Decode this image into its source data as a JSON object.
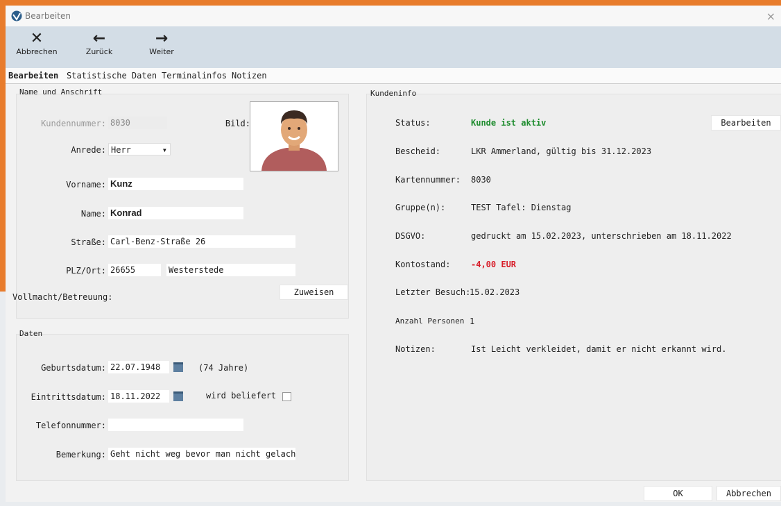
{
  "window": {
    "title": "Bearbeiten",
    "close": "×"
  },
  "toolbar": {
    "cancel": {
      "icon": "✕",
      "label": "Abbrechen"
    },
    "back": {
      "icon": "←",
      "label": "Zurück"
    },
    "forward": {
      "icon": "→",
      "label": "Weiter"
    }
  },
  "tabs": [
    "Bearbeiten",
    "Statistische Daten",
    "Terminalinfos",
    "Notizen"
  ],
  "name_section": {
    "legend": "Name und Anschrift",
    "kundennummer_label": "Kundennummer:",
    "kundennummer": "8030",
    "bild_label": "Bild:",
    "anrede_label": "Anrede:",
    "anrede": "Herr",
    "vorname_label": "Vorname:",
    "vorname": "Kunz",
    "name_label": "Name:",
    "name": "Konrad",
    "strasse_label": "Straße:",
    "strasse": "Carl-Benz-Straße 26",
    "plzort_label": "PLZ/Ort:",
    "plz": "26655",
    "ort": "Westerstede",
    "vollmacht_label": "Vollmacht/Betreuung:",
    "zuweisen": "Zuweisen"
  },
  "daten_section": {
    "legend": "Daten",
    "geburtsdatum_label": "Geburtsdatum:",
    "geburtsdatum": "22.07.1948",
    "alter": "(74 Jahre)",
    "eintrittsdatum_label": "Eintrittsdatum:",
    "eintrittsdatum": "18.11.2022",
    "beliefert_label": "wird beliefert",
    "telefon_label": "Telefonnummer:",
    "telefon": "",
    "bemerkung_label": "Bemerkung:",
    "bemerkung": "Geht nicht weg bevor man nicht gelach"
  },
  "kundeninfo": {
    "legend": "Kundeninfo",
    "edit_button": "Bearbeiten",
    "rows": [
      {
        "label": "Status:",
        "value": "Kunde ist aktiv"
      },
      {
        "label": "Bescheid:",
        "value": "LKR Ammerland, gültig bis 31.12.2023"
      },
      {
        "label": "Kartennummer:",
        "value": "8030"
      },
      {
        "label": "Gruppe(n):",
        "value": "TEST Tafel: Dienstag"
      },
      {
        "label": "DSGVO:",
        "value": "gedruckt am 15.02.2023, unterschrieben am 18.11.2022"
      },
      {
        "label": "Kontostand:",
        "value": "-4,00 EUR"
      },
      {
        "label": "Letzter Besuch:",
        "value": "15.02.2023"
      },
      {
        "label": "Anzahl Personen",
        "value": "1"
      },
      {
        "label": "Notizen:",
        "value": "Ist Leicht verkleidet, damit er nicht erkannt wird."
      }
    ]
  },
  "footer": {
    "ok": "OK",
    "cancel": "Abbrechen"
  },
  "colors": {
    "status_active": "#1e8c2e",
    "balance_negative": "#d81e2a",
    "accent": "#e87c2c"
  }
}
